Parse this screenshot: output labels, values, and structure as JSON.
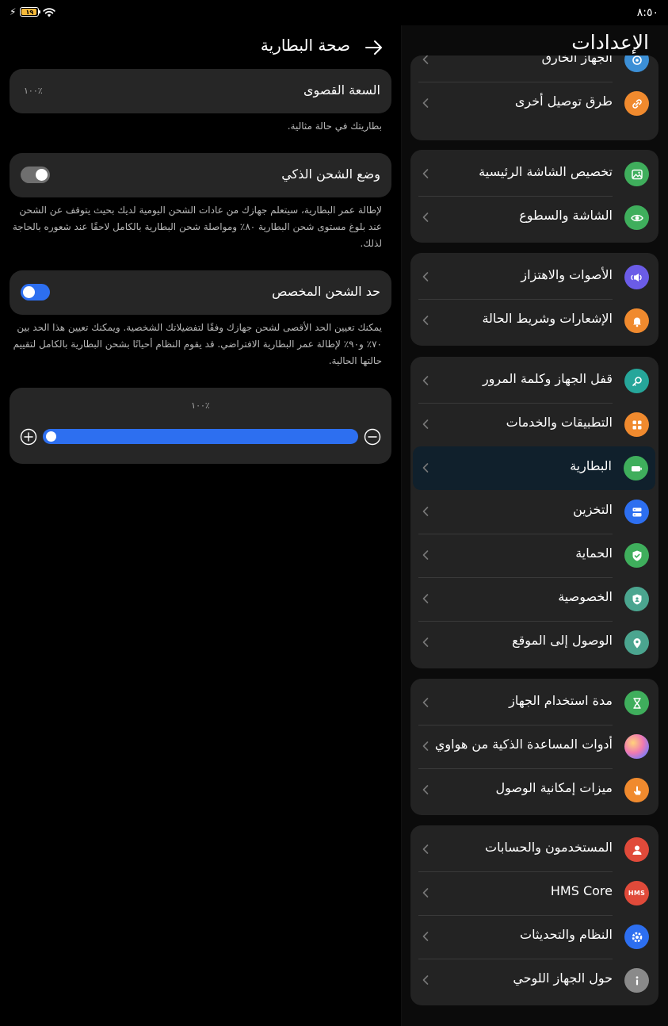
{
  "status_bar": {
    "time": "٨:٥٠",
    "battery_level": "١٩"
  },
  "detail": {
    "back_icon": "arrow-right-icon",
    "title": "صحة البطارية",
    "max_capacity": {
      "label": "السعة القصوى",
      "value": "١٠٠٪"
    },
    "max_capacity_note": "بطاريتك في حالة مثالية.",
    "smart_charging": {
      "label": "وضع الشحن الذكي",
      "enabled": false
    },
    "smart_charging_desc": "لإطالة عمر البطارية، سيتعلم جهازك من عادات الشحن اليومية لديك بحيث يتوقف عن الشحن عند بلوغ مستوى شحن البطارية ٨٠٪ ومواصلة شحن البطارية بالكامل لاحقًا عند شعوره بالحاجة لذلك.",
    "custom_limit": {
      "label": "حد الشحن المخصص",
      "enabled": true
    },
    "custom_limit_desc": "يمكنك تعيين الحد الأقصى لشحن جهازك وفقًا لتفضيلاتك الشخصية. ويمكنك تعيين هذا الحد بين ٧٠٪ و٩٠٪ لإطالة عمر البطارية الافتراضي. قد يقوم النظام أحيانًا بشحن البطارية بالكامل لتقييم حالتها الحالية.",
    "slider": {
      "value_label": "١٠٠٪",
      "value_percent": 100
    }
  },
  "settings": {
    "title": "الإعدادات",
    "groups": [
      {
        "items": [
          {
            "label": "الجهاز الخارق",
            "icon": "super-device-icon",
            "color": "#3c8fd6"
          },
          {
            "label": "طرق توصيل أخرى",
            "icon": "link-icon",
            "color": "#f08a2e"
          }
        ]
      },
      {
        "items": [
          {
            "label": "تخصيص الشاشة الرئيسية",
            "icon": "image-icon",
            "color": "#3fae5c"
          },
          {
            "label": "الشاشة والسطوع",
            "icon": "eye-icon",
            "color": "#3fae5c"
          }
        ]
      },
      {
        "items": [
          {
            "label": "الأصوات والاهتزاز",
            "icon": "speaker-icon",
            "color": "#6b5ce7"
          },
          {
            "label": "الإشعارات وشريط الحالة",
            "icon": "bell-icon",
            "color": "#f08a2e"
          }
        ]
      },
      {
        "items": [
          {
            "label": "قفل الجهاز وكلمة المرور",
            "icon": "key-icon",
            "color": "#26a69a"
          },
          {
            "label": "التطبيقات والخدمات",
            "icon": "apps-icon",
            "color": "#f08a2e"
          },
          {
            "label": "البطارية",
            "icon": "battery-icon",
            "color": "#3fae5c",
            "active": true
          },
          {
            "label": "التخزين",
            "icon": "storage-icon",
            "color": "#2d6ff0"
          },
          {
            "label": "الحماية",
            "icon": "shield-check-icon",
            "color": "#3fae5c"
          },
          {
            "label": "الخصوصية",
            "icon": "privacy-shield-icon",
            "color": "#4ba58f"
          },
          {
            "label": "الوصول إلى الموقع",
            "icon": "location-pin-icon",
            "color": "#4ba58f"
          }
        ]
      },
      {
        "items": [
          {
            "label": "مدة استخدام الجهاز",
            "icon": "hourglass-icon",
            "color": "#3fae5c"
          },
          {
            "label": "أدوات المساعدة الذكية من هواوي",
            "icon": "assistant-orb-icon",
            "color": "#c77be6"
          },
          {
            "label": "ميزات إمكانية الوصول",
            "icon": "hand-touch-icon",
            "color": "#f08a2e"
          }
        ]
      },
      {
        "items": [
          {
            "label": "المستخدمون والحسابات",
            "icon": "user-icon",
            "color": "#e04a3a"
          },
          {
            "label": "HMS Core",
            "icon": "hms-logo-icon",
            "color": "#e04a3a",
            "logo_text": "HMS"
          },
          {
            "label": "النظام والتحديثات",
            "icon": "system-gear-icon",
            "color": "#2d6ff0"
          },
          {
            "label": "حول الجهاز اللوحي",
            "icon": "info-icon",
            "color": "#8a8a8a"
          }
        ]
      }
    ]
  }
}
